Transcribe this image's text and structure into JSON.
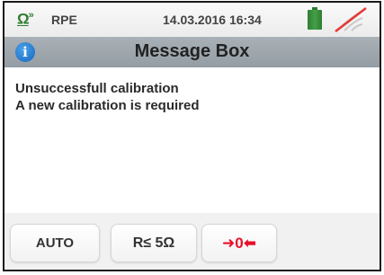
{
  "status_bar": {
    "mode_symbol": "Ω",
    "mode_waves": "»",
    "mode_label": "RPE",
    "datetime": "14.03.2016 16:34",
    "battery_icon": "battery-full-icon",
    "connection_icon": "no-signal-icon",
    "accent_color": "#2e7d32"
  },
  "header": {
    "icon": "info-icon",
    "icon_glyph": "i",
    "title": "Message Box"
  },
  "message": {
    "line1": "Unsuccessfull calibration",
    "line2": "A new calibration is required"
  },
  "softkeys": {
    "auto_label": "AUTO",
    "limit_label": "R≤ 5Ω",
    "zero_label": "➜0⬅",
    "zero_color": "#e8102a"
  }
}
